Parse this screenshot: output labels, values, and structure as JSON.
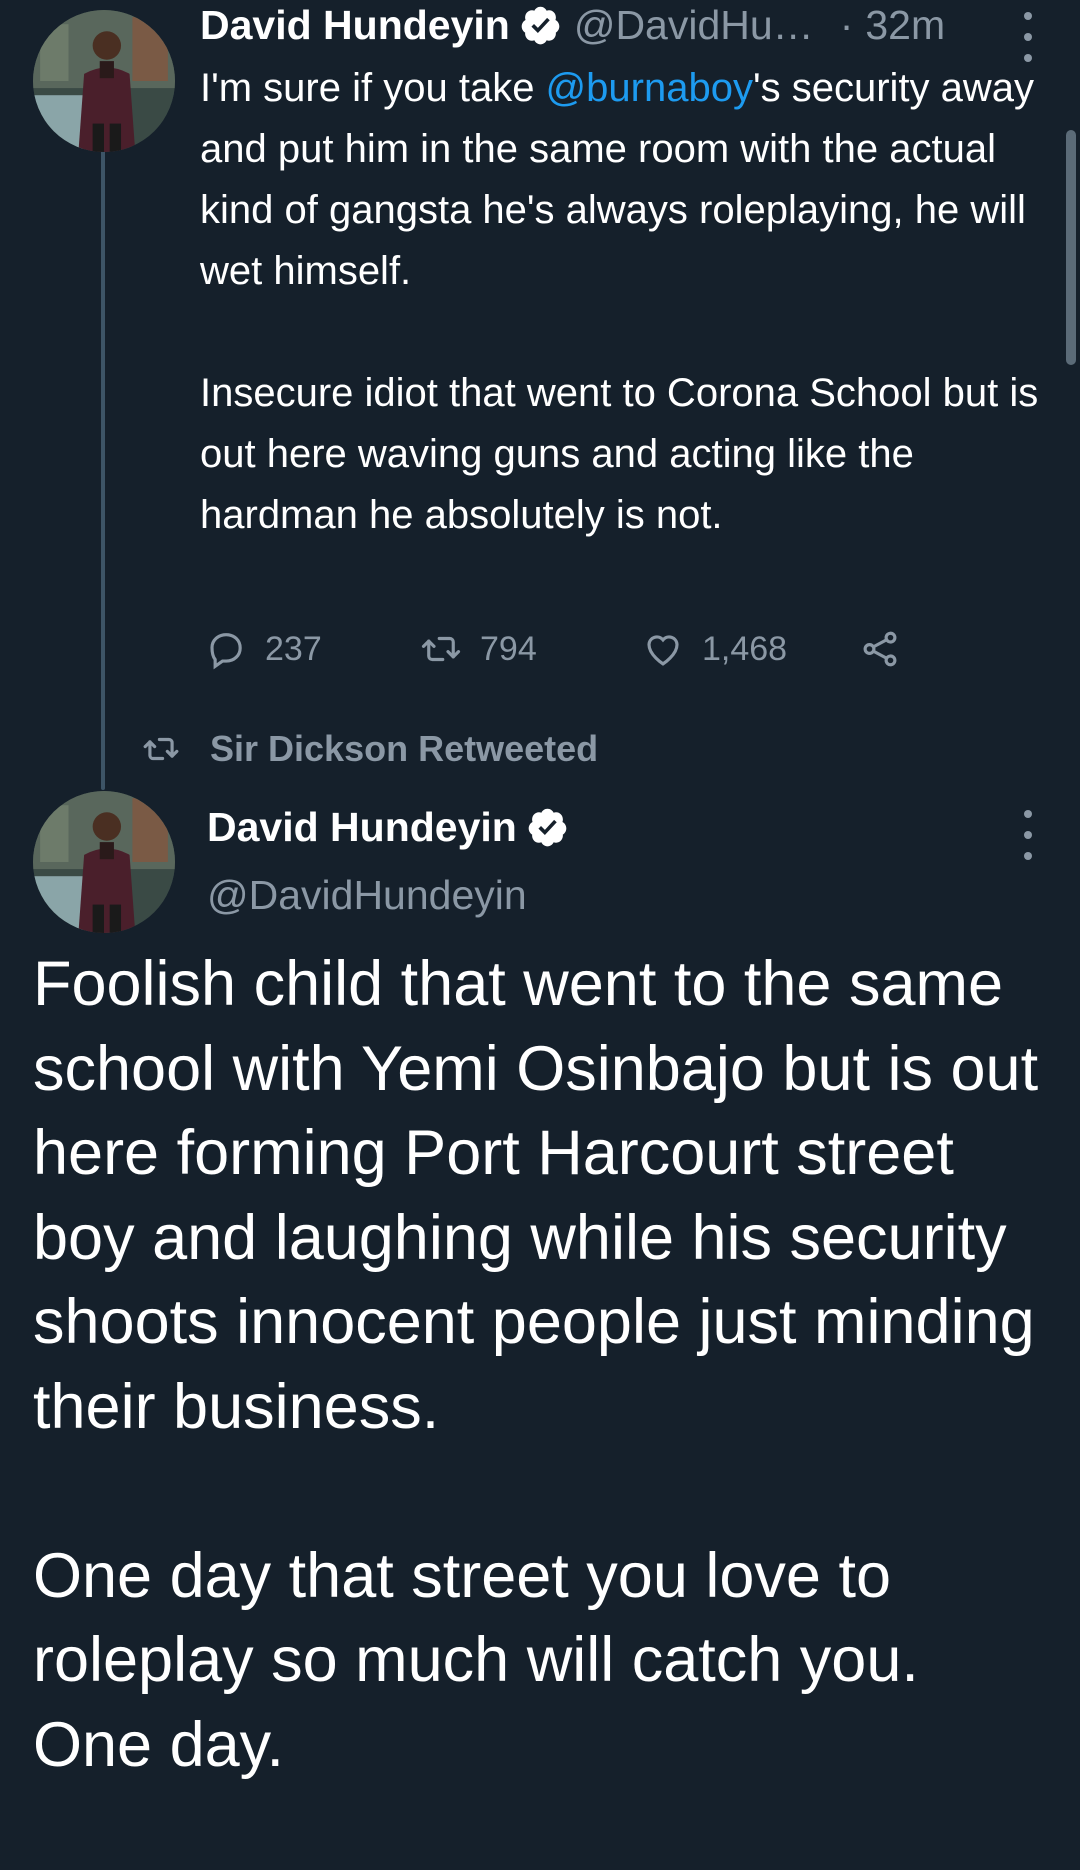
{
  "tweet1": {
    "author_name": "David Hundeyin",
    "handle": "@DavidHu…",
    "separator": "·",
    "time": "32m",
    "text_pre_mention": "I'm sure if you take ",
    "mention": "@burnaboy",
    "text_post_mention": "'s security away and put him in the same room with the actual kind of gangsta he's always roleplaying, he will wet himself.",
    "paragraph2": "Insecure idiot that went to Corona School but is out here waving guns and acting like the hardman he absolutely is not.",
    "replies": "237",
    "retweets": "794",
    "likes": "1,468"
  },
  "retweet_context": {
    "label": "Sir Dickson Retweeted"
  },
  "tweet2": {
    "author_name": "David Hundeyin",
    "handle": "@DavidHundeyin",
    "paragraph1": "Foolish child that went to the same school with Yemi Osinbajo but is out here forming Port Harcourt street boy and laughing while his security shoots innocent people just minding their business.",
    "paragraph2": "One day that street you love to roleplay so much will catch you. One day."
  },
  "colors": {
    "background": "#15202b",
    "text": "#ffffff",
    "secondary": "#8b98a5",
    "link": "#1d9bf0",
    "thread_line": "#3d5466"
  },
  "icons": [
    "avatar-photo",
    "verified-badge-icon",
    "more-options-icon",
    "reply-icon",
    "retweet-icon",
    "like-icon",
    "share-icon"
  ]
}
